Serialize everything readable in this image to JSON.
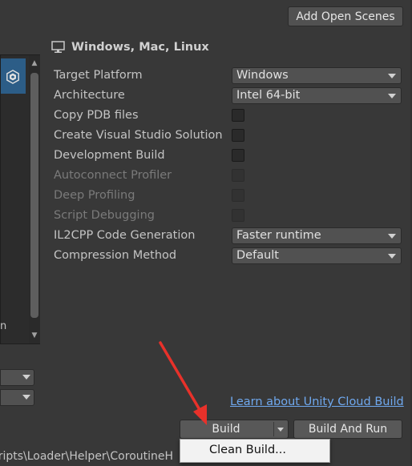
{
  "toolbar": {
    "add_open_scenes_label": "Add Open Scenes"
  },
  "platform": {
    "title": "Windows, Mac, Linux",
    "icon": "monitor-icon",
    "left_list_icon": "unity-logo-icon"
  },
  "settings": {
    "target_platform": {
      "label": "Target Platform",
      "value": "Windows"
    },
    "architecture": {
      "label": "Architecture",
      "value": "Intel 64-bit"
    },
    "copy_pdb": {
      "label": "Copy PDB files",
      "checked": false
    },
    "create_vs_solution": {
      "label": "Create Visual Studio Solution",
      "checked": false
    },
    "development_build": {
      "label": "Development Build",
      "checked": false
    },
    "autoconnect_profiler": {
      "label": "Autoconnect Profiler",
      "checked": false,
      "enabled": false
    },
    "deep_profiling": {
      "label": "Deep Profiling",
      "checked": false,
      "enabled": false
    },
    "script_debugging": {
      "label": "Script Debugging",
      "checked": false,
      "enabled": false
    },
    "il2cpp_code_generation": {
      "label": "IL2CPP Code Generation",
      "value": "Faster runtime"
    },
    "compression_method": {
      "label": "Compression Method",
      "value": "Default"
    }
  },
  "left_panel": {
    "clipped_text": "n"
  },
  "bottom": {
    "cloud_link": "Learn about Unity Cloud Build",
    "build_label": "Build",
    "build_and_run_label": "Build And Run",
    "dropdown_menu_item": "Clean Build...",
    "path_text": "cripts\\Loader\\Helper\\CoroutineH"
  },
  "colors": {
    "background": "#383838",
    "button": "#585858",
    "link": "#6fa8ee",
    "selection": "#2c5d87",
    "annotation_arrow": "#e8312a"
  }
}
